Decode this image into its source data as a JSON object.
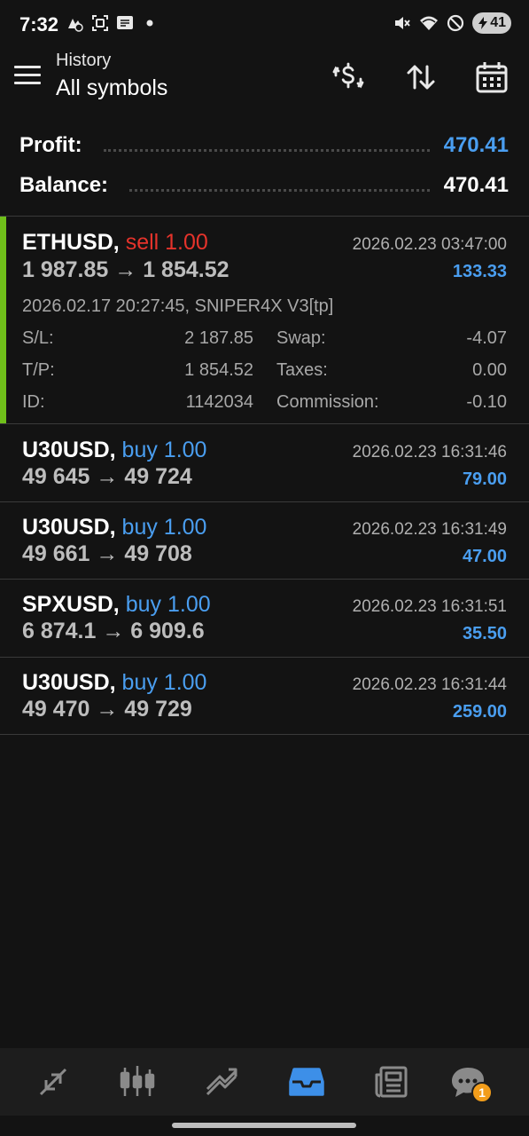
{
  "status_bar": {
    "time": "7:32",
    "battery": "41",
    "icons": [
      "tracking-icon",
      "screenshot-icon",
      "message-icon",
      "dot-icon",
      "mute-icon",
      "wifi-icon",
      "dnd-icon",
      "battery-icon"
    ]
  },
  "app_bar": {
    "subtitle": "History",
    "title": "All symbols",
    "icons": [
      "menu-icon",
      "currency-exchange-icon",
      "sort-icon",
      "calendar-icon"
    ]
  },
  "summary": {
    "profit_label": "Profit:",
    "profit_value": "470.41",
    "balance_label": "Balance:",
    "balance_value": "470.41",
    "profit_color": "#4a9ef0"
  },
  "deals": [
    {
      "symbol": "ETHUSD,",
      "side": "sell 1.00",
      "time": "2026.02.23 03:47:00",
      "prices": "1 987.85 → 1 854.52",
      "profit": "133.33",
      "info": "2026.02.17 20:27:45, SNIPER4X V3[tp]",
      "sl_label": "S/L:",
      "sl_value": "2 187.85",
      "tp_label": "T/P:",
      "tp_value": "1 854.52",
      "id_label": "ID:",
      "id_value": "1142034",
      "swap_label": "Swap:",
      "swap_value": "-4.07",
      "taxes_label": "Taxes:",
      "taxes_value": "0.00",
      "commission_label": "Commission:",
      "commission_value": "-0.10"
    },
    {
      "symbol": "U30USD,",
      "side": "buy 1.00",
      "time": "2026.02.23 16:31:46",
      "prices": "49 645 → 49 724",
      "profit": "79.00"
    },
    {
      "symbol": "U30USD,",
      "side": "buy 1.00",
      "time": "2026.02.23 16:31:49",
      "prices": "49 661 → 49 708",
      "profit": "47.00"
    },
    {
      "symbol": "SPXUSD,",
      "side": "buy 1.00",
      "time": "2026.02.23 16:31:51",
      "prices": "6 874.1 → 6 909.6",
      "profit": "35.50"
    },
    {
      "symbol": "U30USD,",
      "side": "buy 1.00",
      "time": "2026.02.23 16:31:44",
      "prices": "49 470 → 49 729",
      "profit": "259.00"
    }
  ],
  "colors": {
    "sell": "#e5332b",
    "buy": "#4a9ef0",
    "accent_bar": "#6fbf1a",
    "active_nav": "#3d8fe8",
    "badge": "#f29d1b"
  },
  "bottom_nav": {
    "items": [
      "quotes-icon",
      "chart-icon",
      "trade-icon",
      "history-icon",
      "news-icon",
      "chat-icon"
    ],
    "active": "history-icon",
    "chat_badge": "1"
  }
}
